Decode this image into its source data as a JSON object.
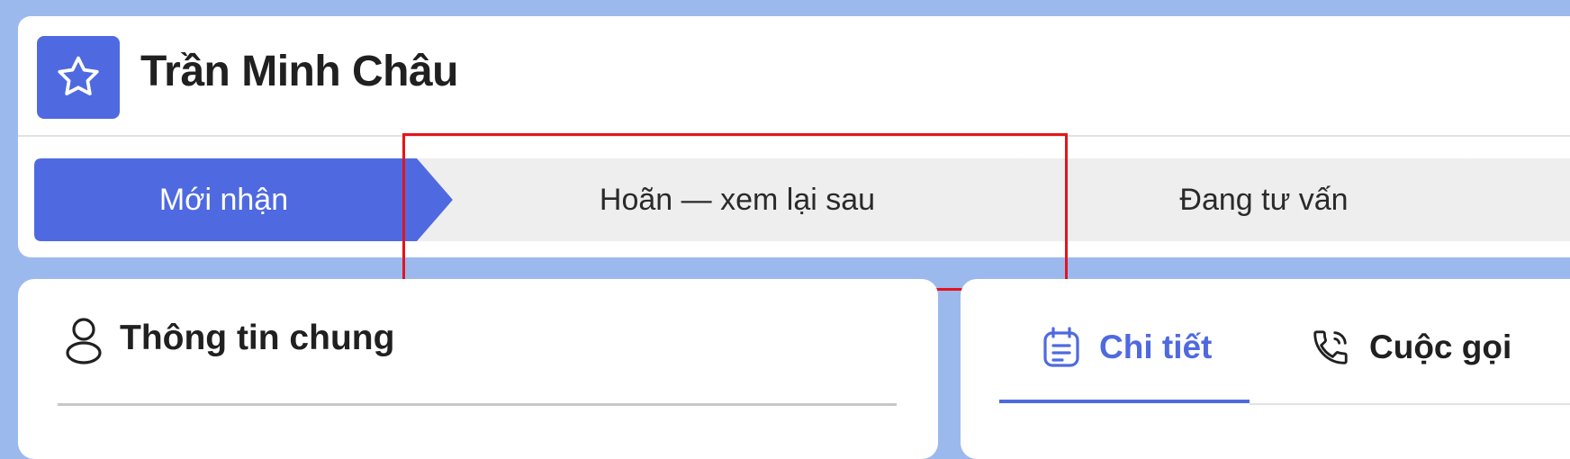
{
  "contact": {
    "name": "Trần Minh Châu",
    "avatar_icon": "star-icon",
    "accent_color": "#4f6ae0"
  },
  "pipeline": {
    "stages": [
      {
        "label": "Mới nhận",
        "active": true
      },
      {
        "label": "Hoãn — xem lại sau",
        "active": false
      },
      {
        "label": "Đang tư vấn",
        "active": false
      }
    ],
    "active_color": "#4f6ae0",
    "inactive_color": "#eeeeee"
  },
  "general_info": {
    "title": "Thông tin chung",
    "icon": "user-icon"
  },
  "tabs": [
    {
      "label": "Chi tiết",
      "icon": "calendar-icon",
      "active": true
    },
    {
      "label": "Cuộc gọi",
      "icon": "phone-icon",
      "active": false
    }
  ],
  "highlight_color": "#e3141c"
}
